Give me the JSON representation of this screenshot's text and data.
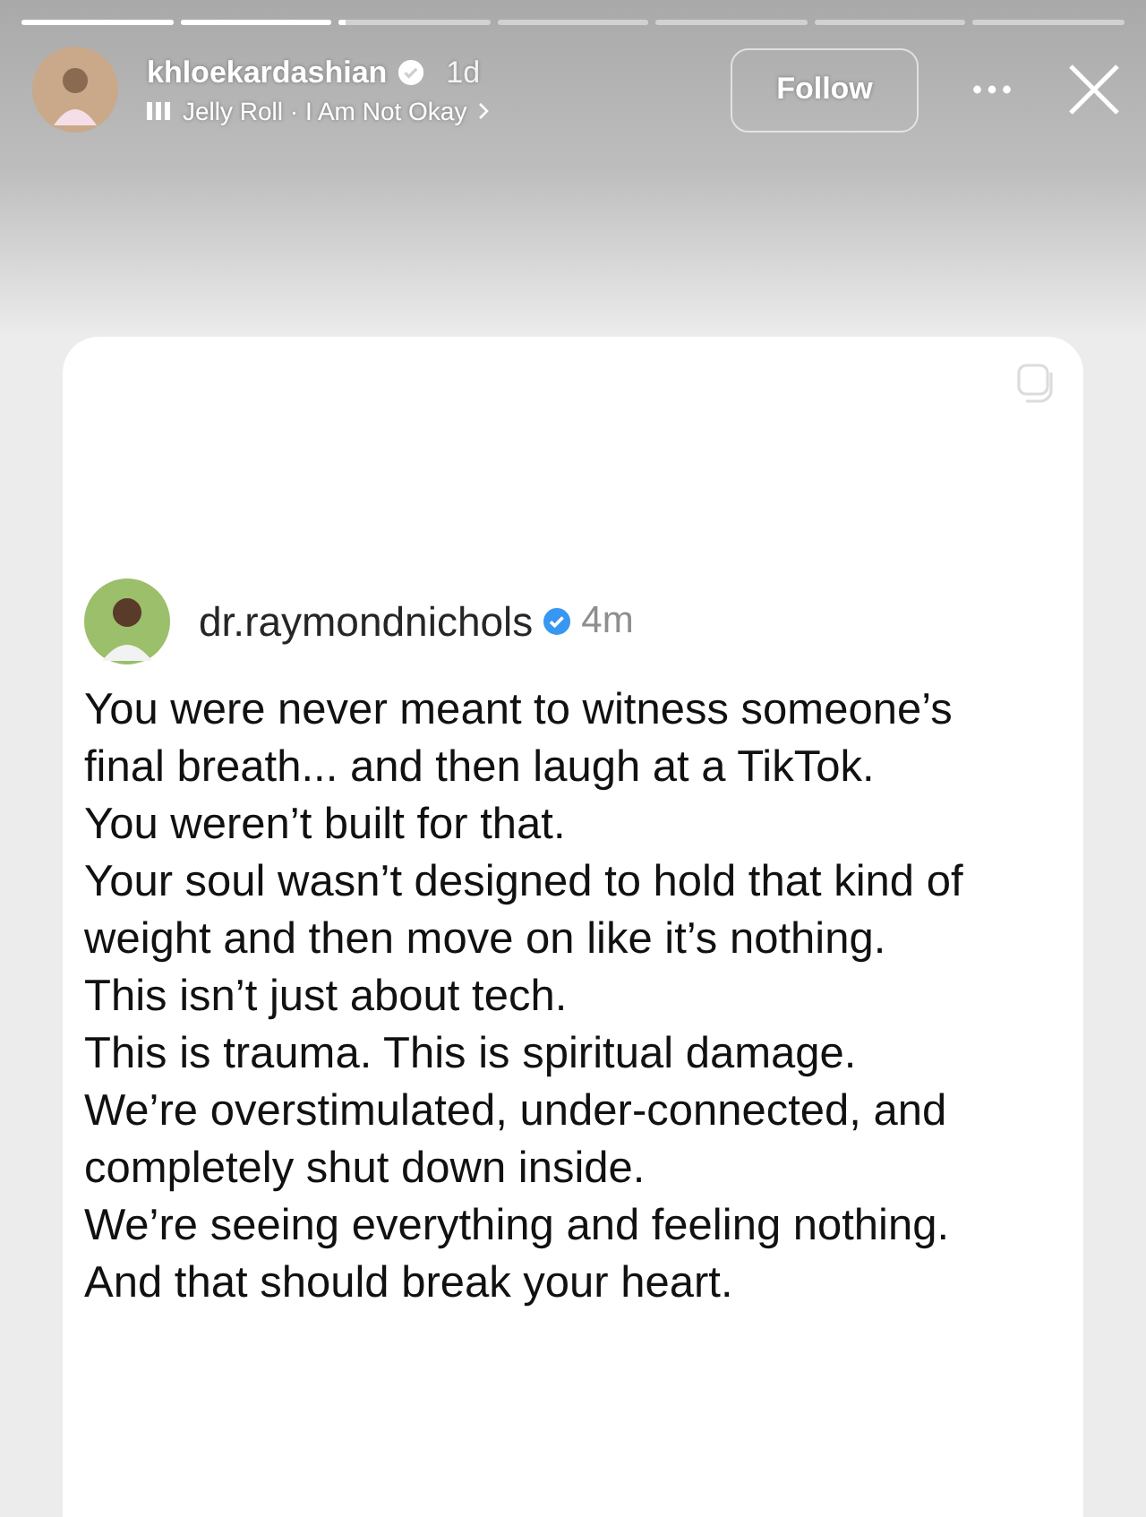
{
  "progress": [
    {
      "kind": "played",
      "level": 1
    },
    {
      "kind": "played",
      "level": 1
    },
    {
      "kind": "playing",
      "level": 0.05
    },
    {
      "kind": "upcoming"
    },
    {
      "kind": "upcoming"
    },
    {
      "kind": "upcoming"
    },
    {
      "kind": "upcoming"
    }
  ],
  "story_header": {
    "username": "khloekardashian",
    "verified": true,
    "time": "1d",
    "music": "Jelly Roll · I Am Not Okay",
    "follow_button": "Follow"
  },
  "post": {
    "username": "dr.raymondnichols",
    "verified": true,
    "time": "4m",
    "lines": [
      "You were never meant to witness someone’s final breath... and then laugh at a TikTok.",
      "You weren’t built for that.",
      "Your soul wasn’t designed to hold that kind of weight and then move on like it’s nothing.",
      "This isn’t just about tech.",
      "This is trauma. This is spiritual damage.",
      "We’re overstimulated, under-connected, and completely shut down inside.",
      "We’re seeing everything and feeling nothing.",
      "And that should break your heart."
    ]
  }
}
